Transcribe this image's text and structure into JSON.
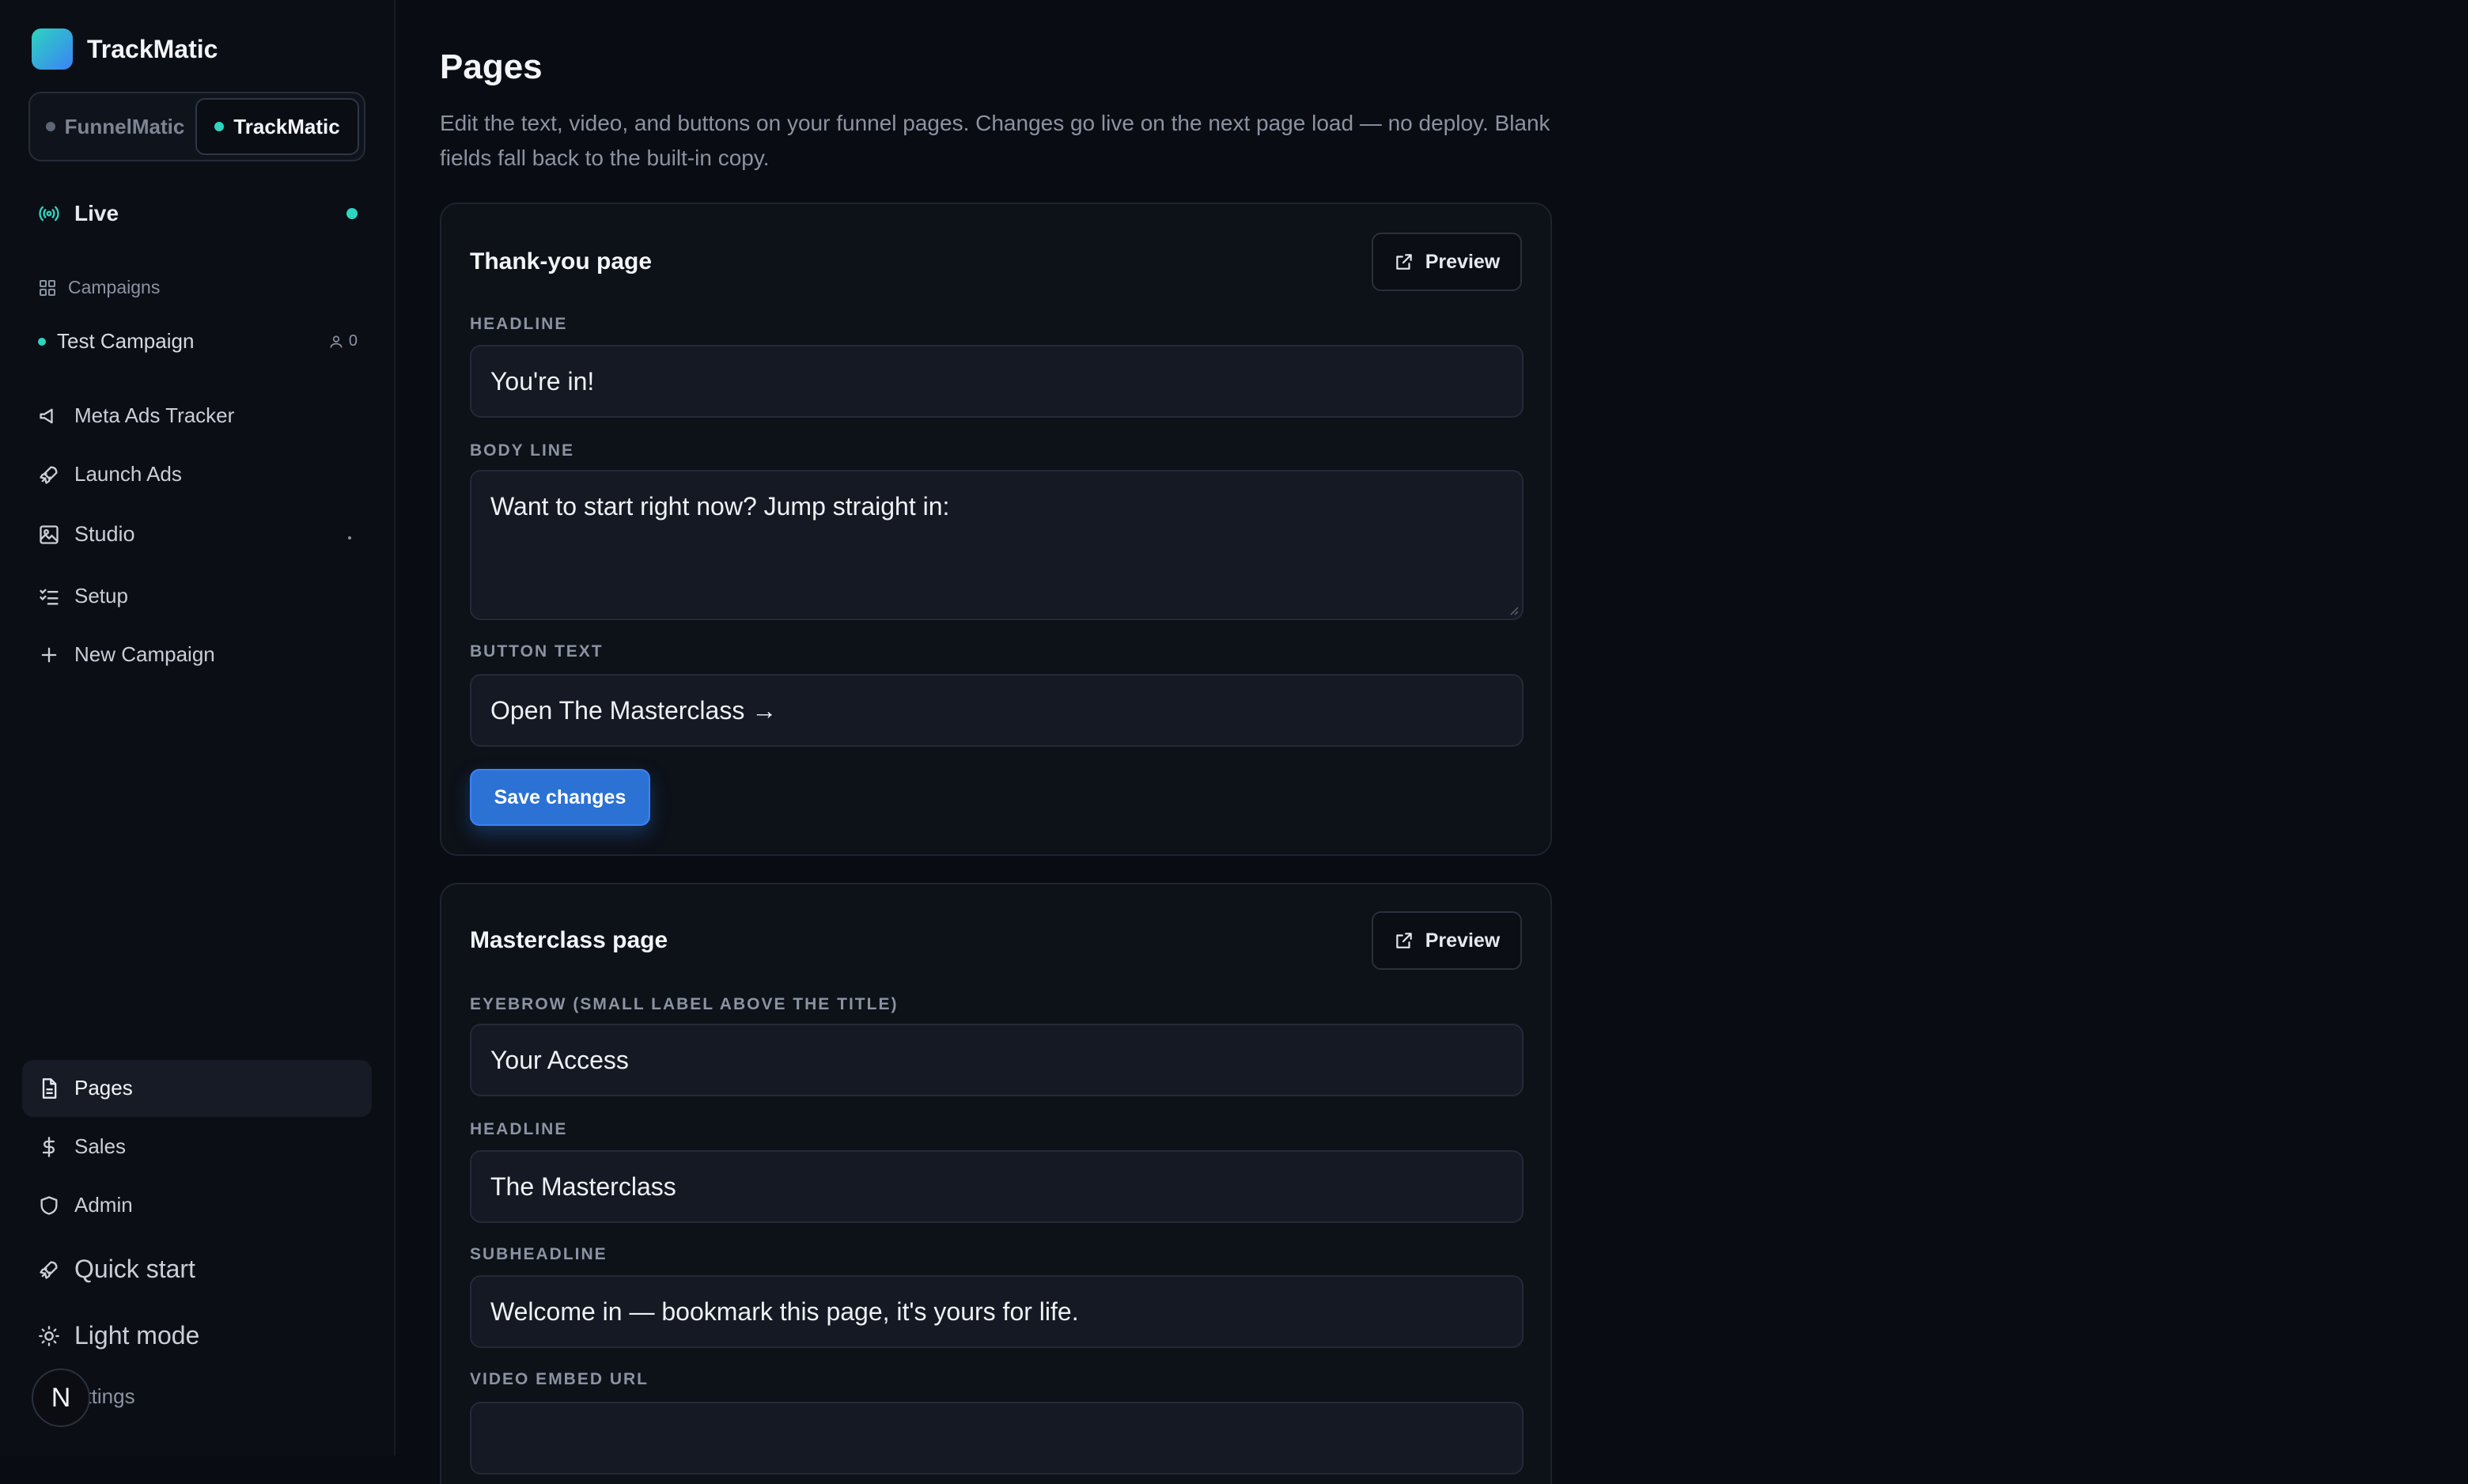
{
  "brand": {
    "name": "TrackMatic"
  },
  "switcher": {
    "funnel": "FunnelMatic",
    "track": "TrackMatic"
  },
  "sidebar": {
    "live": "Live",
    "campaigns_label": "Campaigns",
    "campaign": {
      "name": "Test Campaign",
      "count": "0"
    },
    "items": {
      "meta_ads": "Meta Ads Tracker",
      "launch_ads": "Launch Ads",
      "studio": "Studio",
      "setup": "Setup",
      "new_campaign": "New Campaign",
      "pages": "Pages",
      "sales": "Sales",
      "admin": "Admin",
      "quick_start": "Quick start",
      "light_mode": "Light mode",
      "settings": "ettings"
    },
    "avatar_letter": "N"
  },
  "main": {
    "title": "Pages",
    "description": "Edit the text, video, and buttons on your funnel pages. Changes go live on the next page load — no deploy. Blank fields fall back to the built-in copy.",
    "thankyou": {
      "title": "Thank-you page",
      "preview": "Preview",
      "headline_label": "HEADLINE",
      "headline": "You're in!",
      "body_label": "BODY LINE",
      "body": "Want to start right now? Jump straight in:",
      "button_label": "BUTTON TEXT",
      "button": "Open The Masterclass →",
      "save": "Save changes"
    },
    "masterclass": {
      "title": "Masterclass page",
      "preview": "Preview",
      "eyebrow_label": "EYEBROW (SMALL LABEL ABOVE THE TITLE)",
      "eyebrow": "Your Access",
      "headline_label": "HEADLINE",
      "headline": "The Masterclass",
      "subheadline_label": "SUBHEADLINE",
      "subheadline": "Welcome in — bookmark this page, it's yours for life.",
      "video_label": "VIDEO EMBED URL",
      "video": ""
    }
  },
  "colors": {
    "accent": "#2b72d4",
    "live": "#2dd4bf",
    "background": "#090c12"
  }
}
